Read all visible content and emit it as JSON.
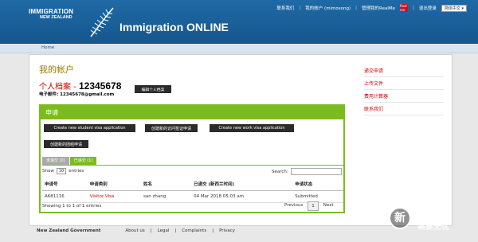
{
  "header": {
    "logo_line1": "IMMIGRATION",
    "logo_line2": "NEW ZEALAND",
    "app_title": "Immigration ONLINE",
    "links": [
      "联系我们",
      "我的帐户 (mimosong)",
      "管理我的RealMe",
      "退出登录"
    ],
    "realme_badge": "Real me",
    "language": "简体中文 ▾"
  },
  "breadcrumb": "Home",
  "account": {
    "title": "我的帐户",
    "profile_label": "个人档案 -",
    "profile_number": "12345678",
    "email_label": "电子邮件:",
    "email": "12345678@gmail.com",
    "edit_button": "编辑个人档案"
  },
  "apply": {
    "heading": "申请",
    "buttons": [
      "Create new student visa application",
      "创建新的访问签证申请",
      "Create new work visa application",
      "创建新的团组申请"
    ],
    "tabs": [
      {
        "label": "未递交 (0)"
      },
      {
        "label": "已递交 (1)"
      }
    ],
    "show_label": "Show",
    "entries_select": "10",
    "entries_label": "entries",
    "search_label": "Search:",
    "columns": [
      "申请号",
      "申请类别",
      "姓名",
      "已递交 (新西兰时间)",
      "申请状态"
    ],
    "rows": [
      {
        "number": "A681116",
        "type": "Visitor Visa",
        "name": "san zhang",
        "submitted": "04 Mar 2018 05:03 am",
        "status": "Submitted"
      }
    ],
    "info": "Showing 1 to 1 of 1 entries",
    "pager": {
      "previous": "Previous",
      "page": "1",
      "next": "Next"
    }
  },
  "sidebar": [
    "递交申请",
    "上传文件",
    "费用计算器",
    "联系我们"
  ],
  "footer": {
    "gov": "New Zealand Government",
    "links": [
      "About us",
      "Legal",
      "Complaints",
      "Privacy"
    ]
  },
  "watermark": {
    "char": "新",
    "line1": "么值得买",
    "line2": "需要无忧"
  },
  "colors": {
    "brand_blue": "#1f6aa6",
    "accent_green": "#7cbb1e",
    "link_red": "#cc0000"
  }
}
